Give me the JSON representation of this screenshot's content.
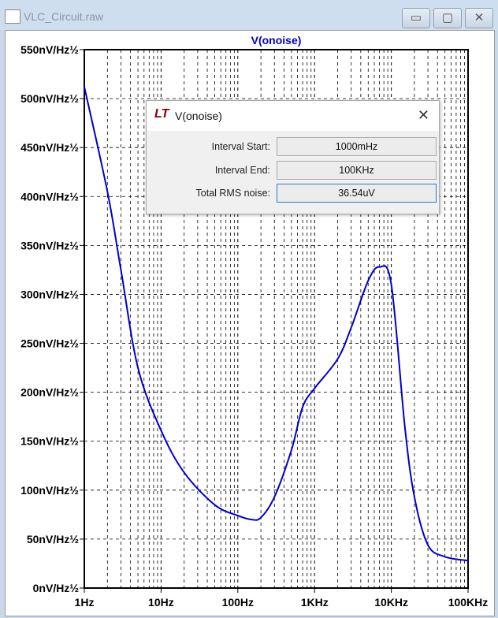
{
  "window": {
    "title": "VLC_Circuit.raw",
    "minimize_icon": "minimize-icon",
    "maximize_icon": "maximize-icon",
    "close_icon": "close-icon"
  },
  "dialog": {
    "title": "V(onoise)",
    "fields": [
      {
        "label": "Interval Start:",
        "value": "1000mHz"
      },
      {
        "label": "Interval End:",
        "value": "100KHz"
      },
      {
        "label": "Total RMS noise:",
        "value": "36.54uV"
      }
    ]
  },
  "chart_data": {
    "type": "line",
    "title": "V(onoise)",
    "xscale": "log",
    "xlim": [
      1,
      100000
    ],
    "ylim": [
      0,
      550
    ],
    "grid": true,
    "xticks": [
      "1Hz",
      "10Hz",
      "100Hz",
      "1KHz",
      "10KHz",
      "100KHz"
    ],
    "yticks": [
      "0nV/Hz½",
      "50nV/Hz½",
      "100nV/Hz½",
      "150nV/Hz½",
      "200nV/Hz½",
      "250nV/Hz½",
      "300nV/Hz½",
      "350nV/Hz½",
      "400nV/Hz½",
      "450nV/Hz½",
      "500nV/Hz½",
      "550nV/Hz½"
    ],
    "series": [
      {
        "name": "V(onoise)",
        "color": "#0000cc",
        "x": [
          1,
          2,
          3,
          5,
          10,
          20,
          50,
          100,
          150,
          200,
          300,
          500,
          700,
          1000,
          2000,
          3000,
          5000,
          7000,
          10000,
          15000,
          20000,
          30000,
          50000,
          100000
        ],
        "y": [
          512,
          405,
          325,
          225,
          161,
          118,
          85,
          74,
          70,
          72,
          93,
          141,
          185,
          204,
          234,
          266,
          314,
          328,
          310,
          165,
          93,
          44,
          32,
          28
        ]
      }
    ]
  }
}
